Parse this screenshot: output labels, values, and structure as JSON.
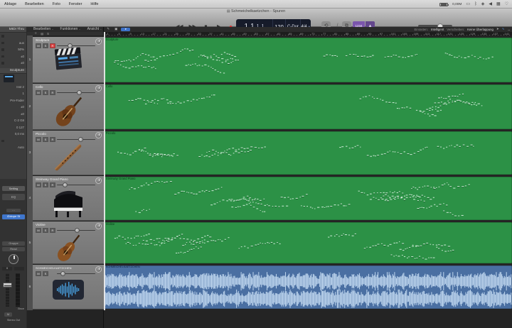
{
  "menubar": {
    "items": [
      "Ablage",
      "Bearbeiten",
      "Foto",
      "Fenster",
      "Hilfe"
    ],
    "status_text": "0,00M",
    "status_icons": [
      "battery",
      "display",
      "bluetooth",
      "siri",
      "volume",
      "mission-control",
      "spotlight"
    ]
  },
  "window_title": "Schmeichelkaetzchen - Spuren",
  "transport": {
    "buttons": [
      "rewind",
      "fast-forward",
      "stop",
      "play",
      "record"
    ]
  },
  "lcd": {
    "bar": "1",
    "beat": "1",
    "division": "1",
    "tick": "1",
    "tempo": "120",
    "key": "C-Dur",
    "time_signature": "4/4",
    "count_in": "1234"
  },
  "toolbar": {
    "menus": [
      "Bearbeiten",
      "Funktionen",
      "Ansicht"
    ],
    "snap_label": "Einrasten:",
    "snap_value": "Intelligent",
    "drag_label": "Verschieben:",
    "drag_value": "Keine Überlappung"
  },
  "ruler": {
    "labels": [
      1,
      5,
      9,
      13,
      17,
      21,
      25,
      29,
      33,
      37,
      41,
      45,
      49,
      53,
      57,
      61,
      65,
      69,
      73,
      77,
      81,
      85,
      89,
      93,
      97,
      101,
      105,
      109,
      113,
      117,
      121,
      125,
      129,
      133,
      137,
      141
    ]
  },
  "inspector": {
    "region_box_title": "MIDI Thru",
    "region_rows": [
      "",
      "aus",
      "50%",
      "±0",
      "±0"
    ],
    "track_box_title": "Sculpture",
    "track_rows": [
      "Inst 2",
      "1",
      "Pre-Fader",
      "±0",
      "±0",
      "C-2  G8",
      "0  127",
      "0,0 ms",
      "",
      "Auto"
    ],
    "strip": {
      "setting": "Setting",
      "eq": "EQ",
      "insert": "iZotope St",
      "group": "Gruppe",
      "automation": "Read",
      "pan_value": "0",
      "bounce": "Bnce",
      "mute": "M",
      "output": "Stereo Out"
    }
  },
  "tracks": [
    {
      "num": "1",
      "name": "Sculpture",
      "icon": "clapperboard",
      "buttons": [
        "M",
        "S",
        "R"
      ],
      "armed": true,
      "knob": 49
    },
    {
      "num": "2",
      "name": "Cello",
      "icon": "cello",
      "buttons": [
        "M",
        "S",
        "R"
      ],
      "armed": false,
      "knob": 62
    },
    {
      "num": "3",
      "name": "Piccolo",
      "icon": "flute",
      "buttons": [
        "M",
        "S",
        "R"
      ],
      "armed": false,
      "knob": 64
    },
    {
      "num": "4",
      "name": "Steinway Grand Piano",
      "icon": "piano",
      "buttons": [
        "M",
        "S",
        "R"
      ],
      "armed": false,
      "knob": 42
    },
    {
      "num": "5",
      "name": "Violine",
      "icon": "violin",
      "buttons": [
        "M",
        "S",
        "R"
      ],
      "armed": false,
      "knob": 59
    },
    {
      "num": "6",
      "name": "SCHMEICHELKAETZCHEN",
      "icon": "waveform",
      "buttons": [
        "M",
        "S"
      ],
      "armed": false,
      "knob": 39
    }
  ],
  "regions": [
    {
      "name": "Sculpture",
      "type": "midi"
    },
    {
      "name": "Cello",
      "type": "midi"
    },
    {
      "name": "Piccolo",
      "type": "midi"
    },
    {
      "name": "Steinway Grand Piano",
      "type": "midi"
    },
    {
      "name": "Violine",
      "type": "midi"
    },
    {
      "name": "SCHMEICHELKAETZCHEN",
      "type": "audio"
    }
  ],
  "colors": {
    "midi_region": "#2c9146",
    "audio_region": "#4a6fa2",
    "waveform": "#c7ddf4",
    "record_red": "#cf2c2c",
    "accent_blue": "#3f76cc",
    "count_in_purple": "#7b55ad"
  }
}
